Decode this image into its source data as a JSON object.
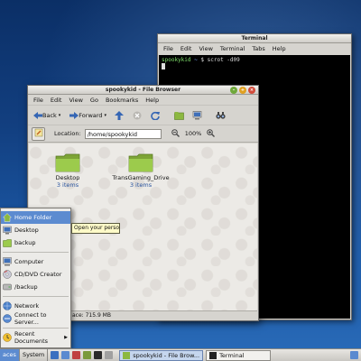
{
  "terminal": {
    "title": "Terminal",
    "menu": [
      "File",
      "Edit",
      "View",
      "Terminal",
      "Tabs",
      "Help"
    ],
    "prompt_user": "spookykid",
    "prompt_path": "~",
    "prompt_symbol": "$",
    "command": "scrot -d09"
  },
  "file_browser": {
    "title": "spookykid - File Browser",
    "menu": [
      "File",
      "Edit",
      "View",
      "Go",
      "Bookmarks",
      "Help"
    ],
    "toolbar": {
      "back": "Back",
      "forward": "Forward"
    },
    "location_label": "Location:",
    "location_value": "/home/spookykid",
    "zoom": "100%",
    "items": [
      {
        "name": "Desktop",
        "count": "3 items"
      },
      {
        "name": "TransGaming_Drive",
        "count": "3 items"
      }
    ],
    "status": "ace: 715.9 MB"
  },
  "places_menu": {
    "items": [
      {
        "label": "Home Folder",
        "icon": "home-icon"
      },
      {
        "label": "Desktop",
        "icon": "desktop-icon"
      },
      {
        "label": "backup",
        "icon": "folder-icon"
      },
      {
        "label": "Computer",
        "icon": "computer-icon"
      },
      {
        "label": "CD/DVD Creator",
        "icon": "disc-icon"
      },
      {
        "label": "/backup",
        "icon": "drive-icon"
      },
      {
        "label": "Network",
        "icon": "network-icon"
      },
      {
        "label": "Connect to Server...",
        "icon": "server-icon"
      },
      {
        "label": "Recent Documents",
        "icon": "recent-icon"
      }
    ],
    "tooltip": "Open your personal folder"
  },
  "taskbar": {
    "places": "aces",
    "system": "System",
    "tasks": [
      "spookykid - File Brow...",
      "Terminal"
    ]
  },
  "colors": {
    "accent": "#5c8bd0",
    "folder": "#8cb840",
    "desktop_bg": "#123f80"
  }
}
